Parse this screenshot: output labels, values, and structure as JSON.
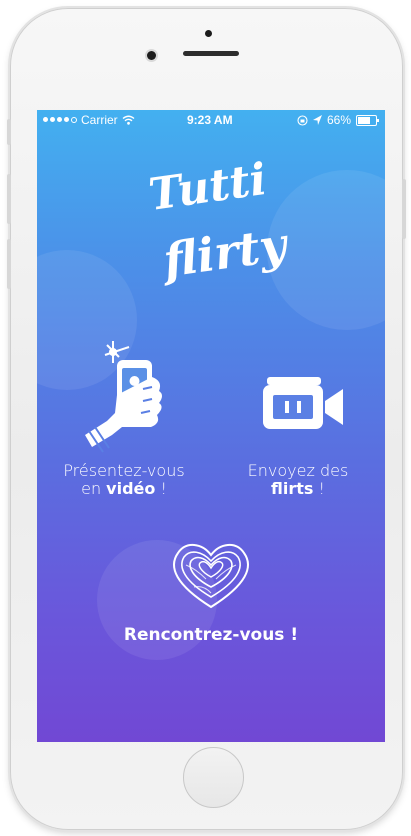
{
  "status_bar": {
    "carrier": "Carrier",
    "time": "9:23 AM",
    "battery_percent": "66%"
  },
  "logo": {
    "line1": "Tutti",
    "line2": "flirty"
  },
  "features": [
    {
      "text_before": "Présentez-vous",
      "text_prefix": "en ",
      "text_bold": "vidéo",
      "text_suffix": " !",
      "icon": "hand-phone-selfie-icon"
    },
    {
      "text_before": "Envoyez des",
      "text_prefix": "",
      "text_bold": "flirts",
      "text_suffix": " !",
      "icon": "video-camera-icon"
    }
  ],
  "cta": {
    "label": "Rencontrez-vous !",
    "icon": "fingerprint-heart-icon"
  },
  "colors": {
    "gradient_top": "#43b0f0",
    "gradient_bottom": "#7148d4",
    "text": "#ffffff"
  }
}
